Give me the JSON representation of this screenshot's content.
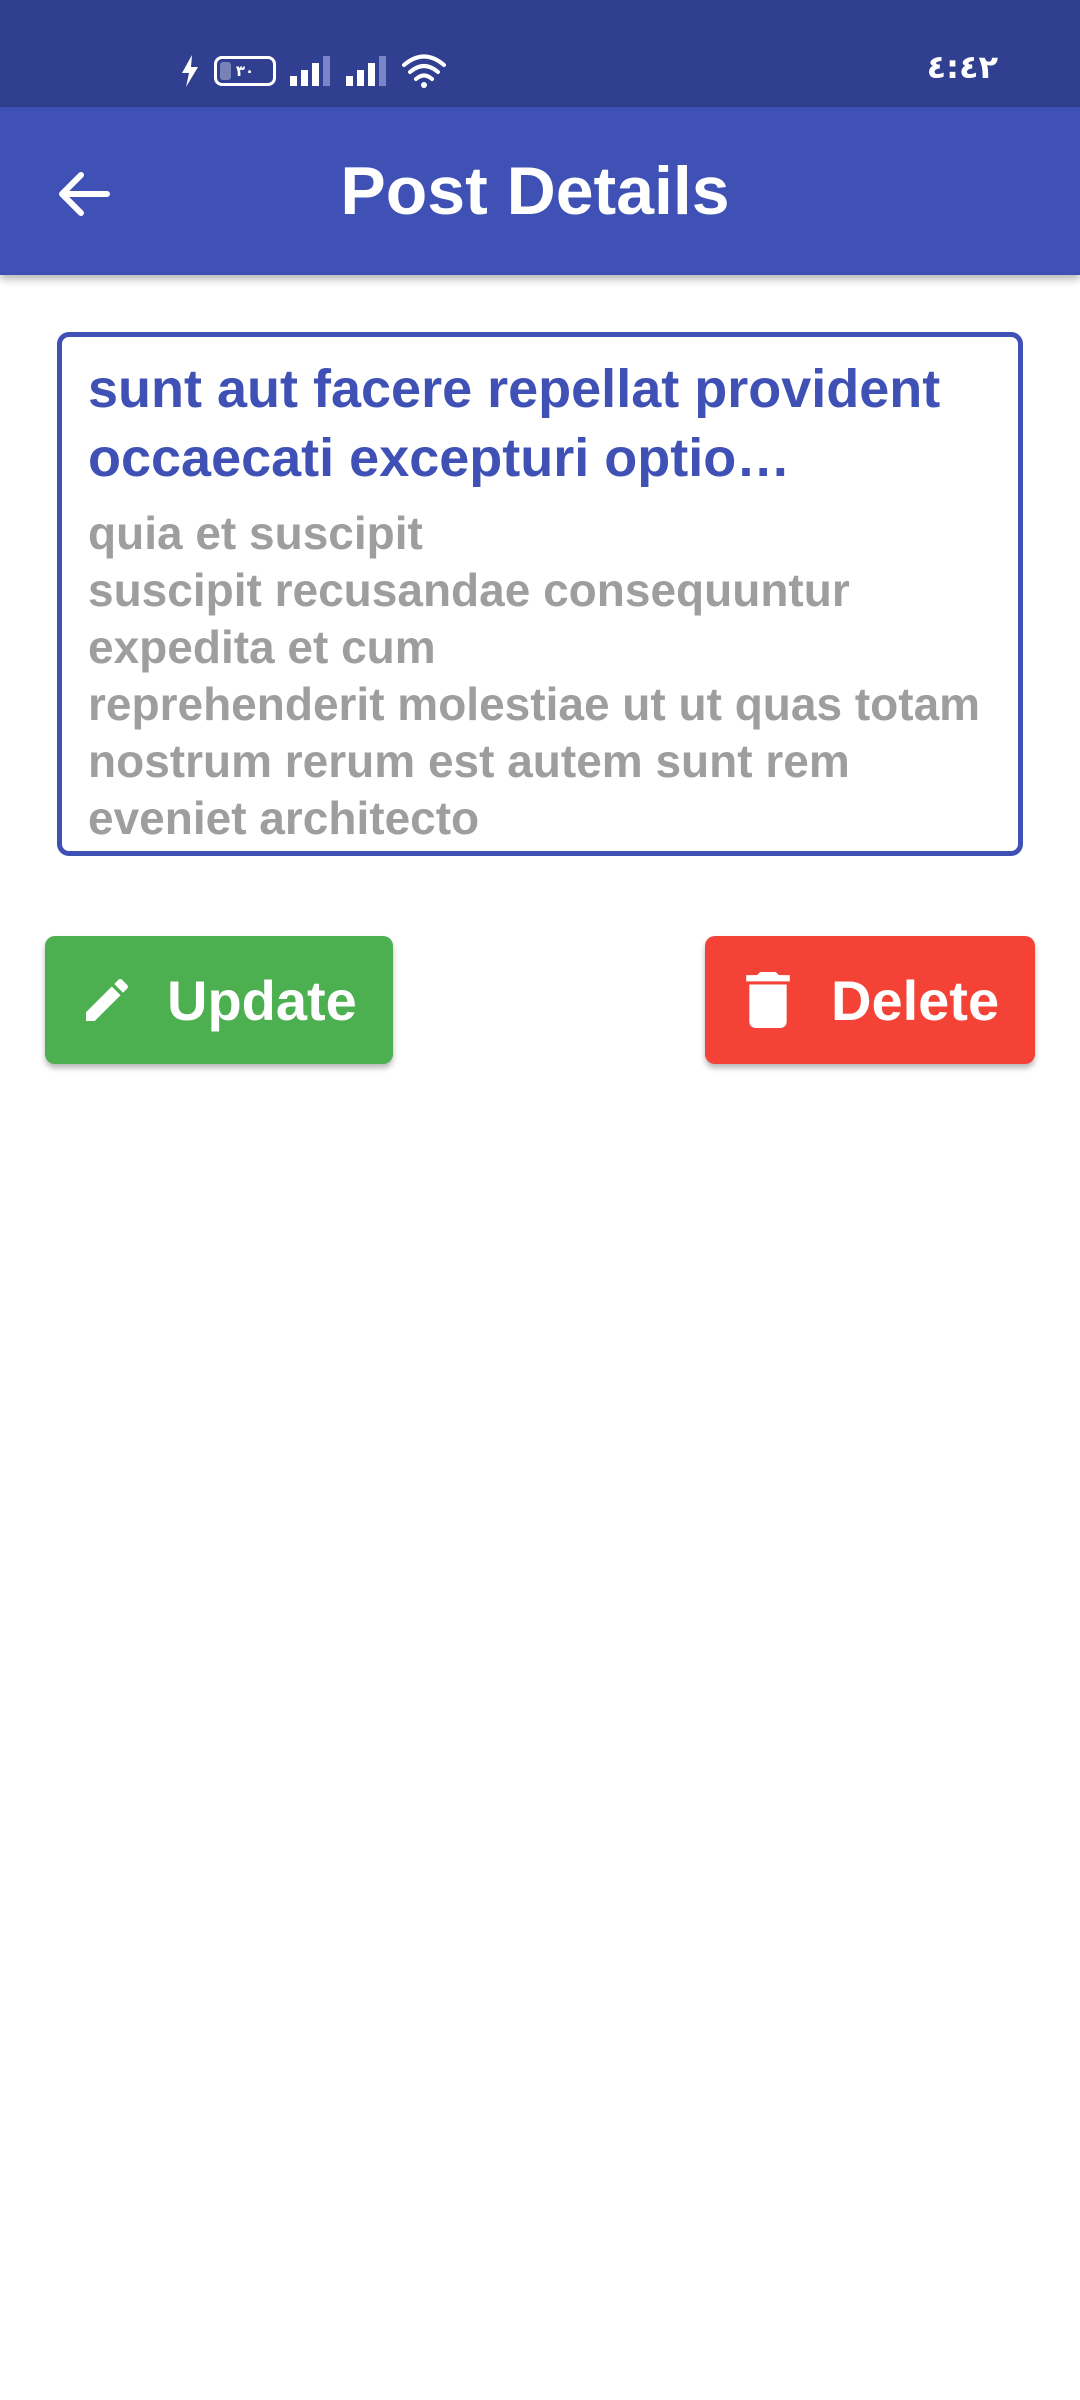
{
  "status_bar": {
    "time": "٤:٤٢",
    "battery_level": "٣٠",
    "battery_percent": 30,
    "icons": [
      "charging-bolt-icon",
      "battery-icon",
      "signal-icon",
      "signal-icon",
      "wifi-icon"
    ]
  },
  "app_bar": {
    "title": "Post Details",
    "back_icon": "arrow-back-icon"
  },
  "post": {
    "title": "sunt aut facere repellat provident occaecati excepturi optio reprehenderit",
    "body": "quia et suscipit\nsuscipit recusandae consequuntur expedita et cum\nreprehenderit molestiae ut ut quas totam\nnostrum rerum est autem sunt rem eveniet architecto"
  },
  "actions": {
    "update_label": "Update",
    "update_icon": "pencil-icon",
    "delete_label": "Delete",
    "delete_icon": "trash-icon"
  },
  "colors": {
    "status_bar": "#303f8f",
    "primary": "#3f51b5",
    "update": "#4caf50",
    "delete": "#f44336",
    "body_text": "#9e9e9e"
  }
}
